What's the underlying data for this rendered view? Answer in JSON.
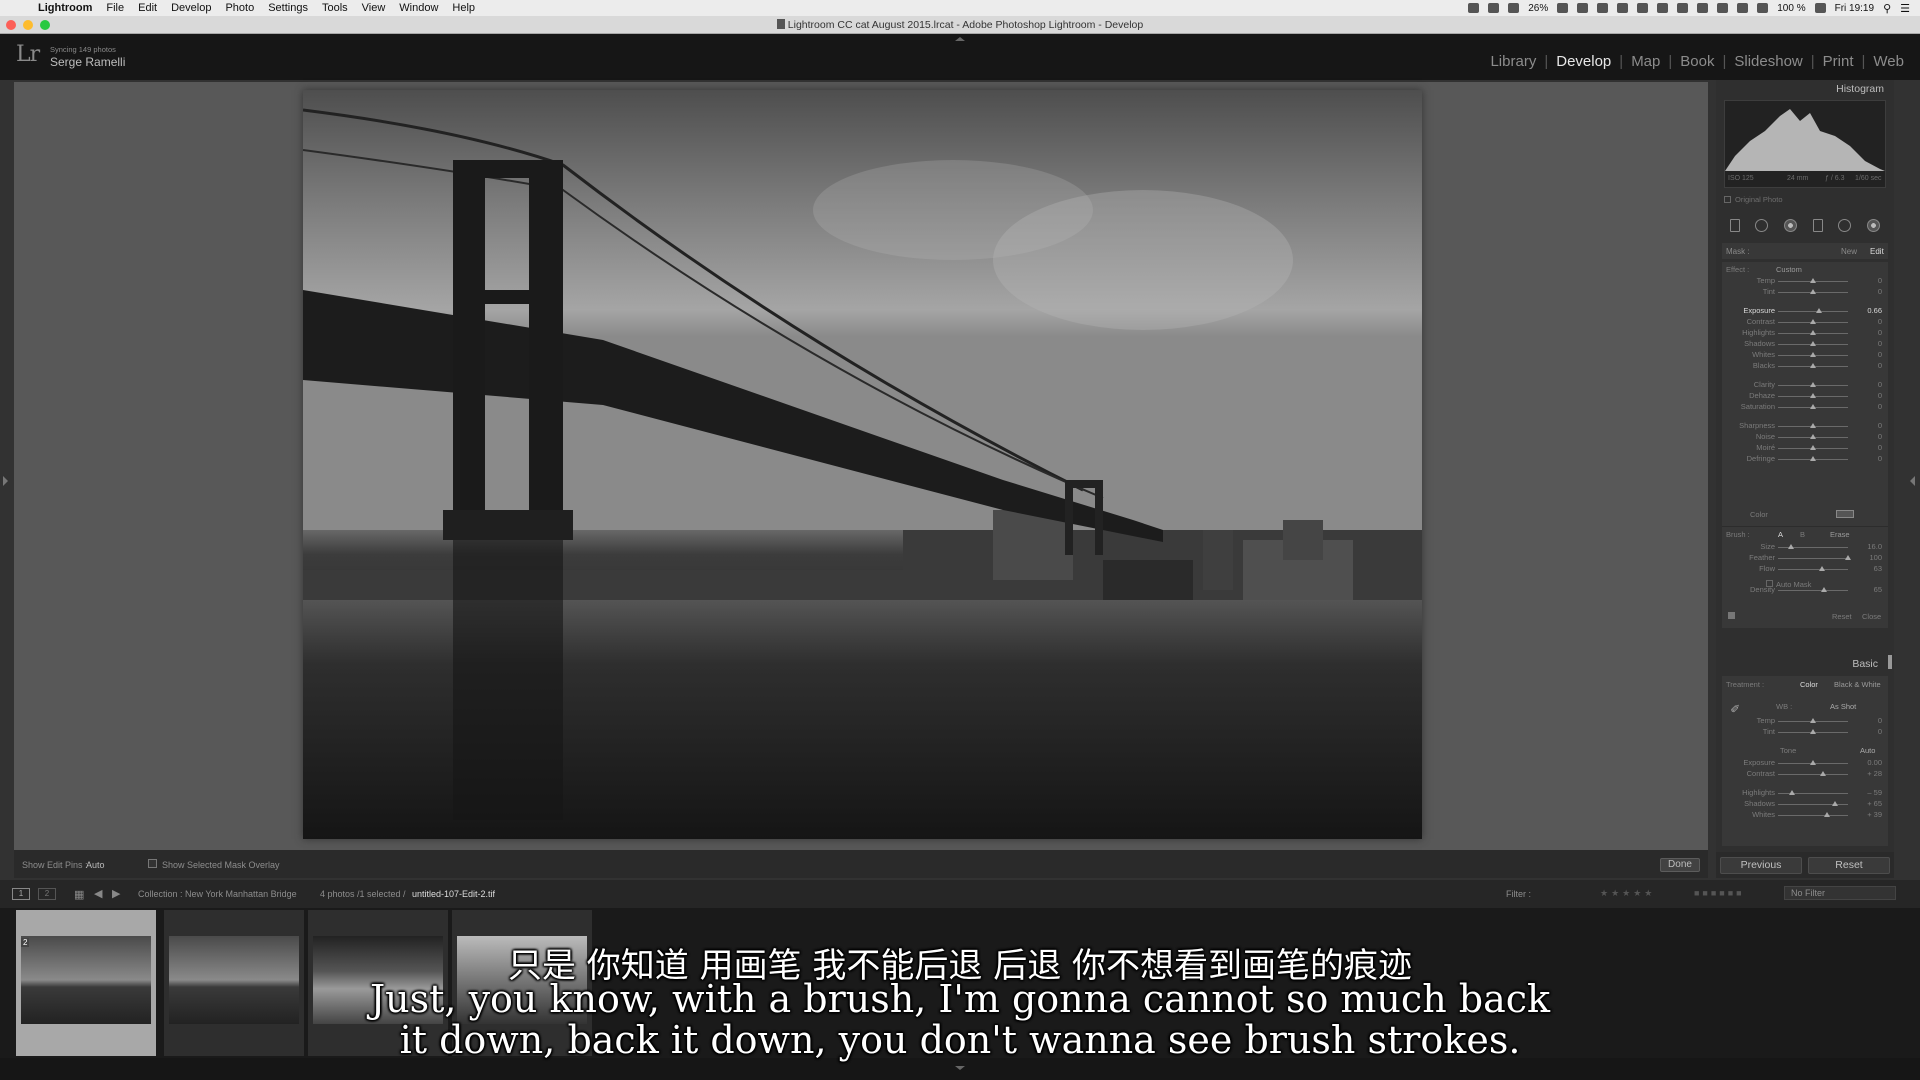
{
  "menubar": {
    "items": [
      "Lightroom",
      "File",
      "Edit",
      "Develop",
      "Photo",
      "Settings",
      "Tools",
      "View",
      "Window",
      "Help"
    ],
    "battery_small": "26%",
    "battery": "100 %",
    "clock": "Fri 19:19"
  },
  "window": {
    "title": "Lightroom CC cat August 2015.lrcat - Adobe Photoshop Lightroom - Develop"
  },
  "identity": {
    "logo": "Lr",
    "sync_status": "Syncing 149 photos",
    "user": "Serge Ramelli"
  },
  "modules": [
    {
      "label": "Library",
      "active": false
    },
    {
      "label": "Develop",
      "active": true
    },
    {
      "label": "Map",
      "active": false
    },
    {
      "label": "Book",
      "active": false
    },
    {
      "label": "Slideshow",
      "active": false
    },
    {
      "label": "Print",
      "active": false
    },
    {
      "label": "Web",
      "active": false
    }
  ],
  "image_toolbar": {
    "show_edit_pins_label": "Show Edit Pins :",
    "show_edit_pins_value": "Auto",
    "show_mask_overlay_label": "Show Selected Mask Overlay",
    "done_label": "Done"
  },
  "histogram": {
    "title": "Histogram",
    "iso": "ISO 125",
    "focal": "24 mm",
    "aperture": "ƒ / 6.3",
    "shutter": "1/60 sec",
    "original_photo_label": "Original Photo"
  },
  "mask": {
    "label": "Mask :",
    "new_label": "New",
    "edit_label": "Edit"
  },
  "effect": {
    "label": "Effect :",
    "value": "Custom",
    "color_label": "Color",
    "sliders": [
      {
        "name": "Temp",
        "value": "0",
        "pos": 0.5
      },
      {
        "name": "Tint",
        "value": "0",
        "pos": 0.5
      },
      {
        "name": "Exposure",
        "value": "0.66",
        "pos": 0.58,
        "highlight": true
      },
      {
        "name": "Contrast",
        "value": "0",
        "pos": 0.5
      },
      {
        "name": "Highlights",
        "value": "0",
        "pos": 0.5
      },
      {
        "name": "Shadows",
        "value": "0",
        "pos": 0.5
      },
      {
        "name": "Whites",
        "value": "0",
        "pos": 0.5
      },
      {
        "name": "Blacks",
        "value": "0",
        "pos": 0.5
      },
      {
        "name": "Clarity",
        "value": "0",
        "pos": 0.5
      },
      {
        "name": "Dehaze",
        "value": "0",
        "pos": 0.5
      },
      {
        "name": "Saturation",
        "value": "0",
        "pos": 0.5
      },
      {
        "name": "Sharpness",
        "value": "0",
        "pos": 0.5
      },
      {
        "name": "Noise",
        "value": "0",
        "pos": 0.5
      },
      {
        "name": "Moiré",
        "value": "0",
        "pos": 0.5
      },
      {
        "name": "Defringe",
        "value": "0",
        "pos": 0.5
      }
    ]
  },
  "brush": {
    "label": "Brush :",
    "a_label": "A",
    "b_label": "B",
    "erase_label": "Erase",
    "auto_mask_label": "Auto Mask",
    "reset_label": "Reset",
    "close_label": "Close",
    "sliders": [
      {
        "name": "Size",
        "value": "16.0",
        "pos": 0.18
      },
      {
        "name": "Feather",
        "value": "100",
        "pos": 1.0
      },
      {
        "name": "Flow",
        "value": "63",
        "pos": 0.63
      },
      {
        "name": "Density",
        "value": "65",
        "pos": 0.65
      }
    ]
  },
  "basic": {
    "title": "Basic",
    "treatment_label": "Treatment :",
    "color_label": "Color",
    "bw_label": "Black & White",
    "wb_label": "WB :",
    "wb_value": "As Shot",
    "tone_label": "Tone",
    "auto_label": "Auto",
    "wb_sliders": [
      {
        "name": "Temp",
        "value": "0",
        "pos": 0.5
      },
      {
        "name": "Tint",
        "value": "0",
        "pos": 0.5
      }
    ],
    "tone_sliders": [
      {
        "name": "Exposure",
        "value": "0.00",
        "pos": 0.5
      },
      {
        "name": "Contrast",
        "value": "+ 28",
        "pos": 0.64
      },
      {
        "name": "Highlights",
        "value": "– 59",
        "pos": 0.2
      },
      {
        "name": "Shadows",
        "value": "+ 65",
        "pos": 0.82
      },
      {
        "name": "Whites",
        "value": "+ 39",
        "pos": 0.7
      }
    ]
  },
  "nav_buttons": {
    "previous": "Previous",
    "reset": "Reset"
  },
  "filmstrip_bar": {
    "collection": "Collection : New York Manhattan Bridge",
    "count": "4 photos /1 selected /",
    "filename": "untitled-107-Edit-2.tif",
    "filter_label": "Filter :",
    "filter_value": "No Filter"
  },
  "thumbnails": [
    {
      "badge": "2",
      "selected": true
    },
    {
      "badge": "",
      "selected": false
    },
    {
      "badge": "",
      "selected": false
    },
    {
      "badge": "",
      "selected": false
    }
  ],
  "subtitles": {
    "zh": "只是 你知道 用画笔 我不能后退 后退 你不想看到画笔的痕迹",
    "en_line1": "Just, you know, with a brush, I'm gonna cannot so much back",
    "en_line2": "it down, back it down, you don't wanna see brush strokes."
  }
}
